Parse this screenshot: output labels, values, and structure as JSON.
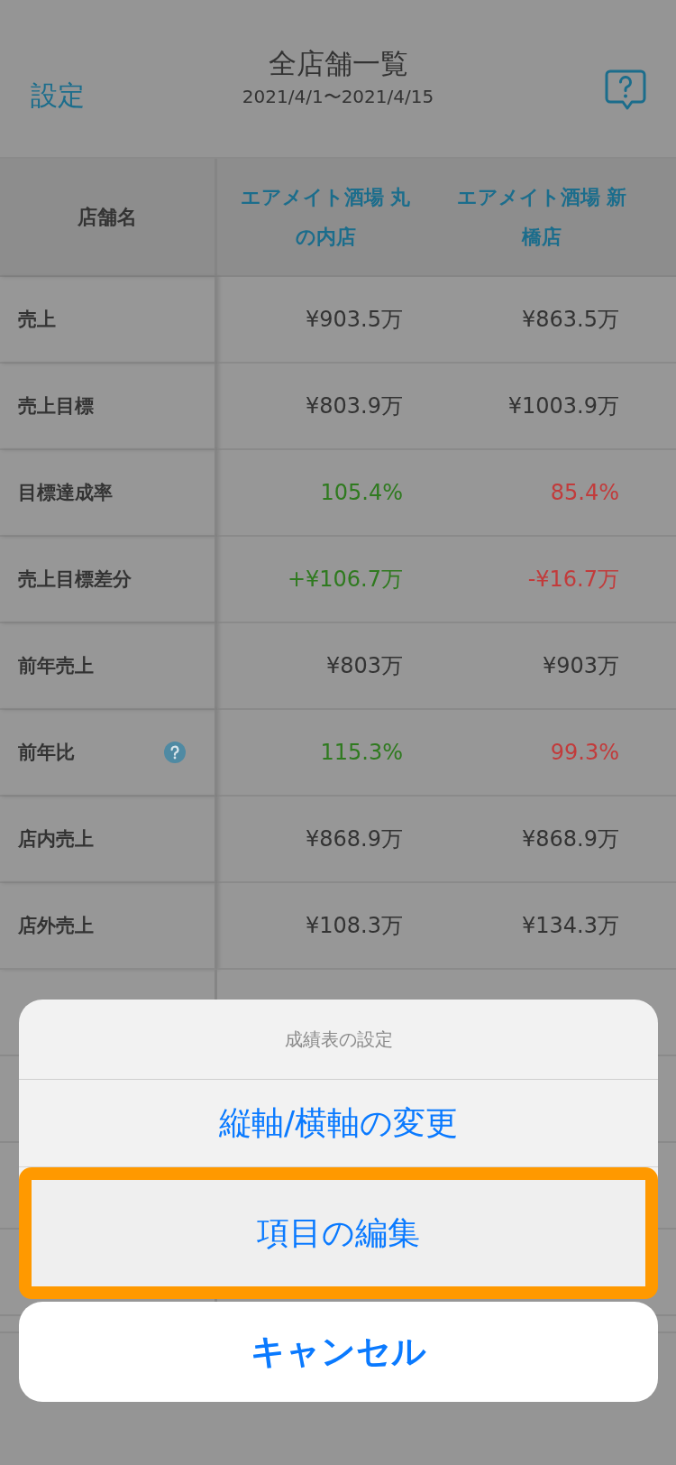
{
  "header": {
    "left_link": "設定",
    "title": "全店舗一覧",
    "subtitle": "2021/4/1〜2021/4/15"
  },
  "table": {
    "corner": "店舗名",
    "columns": [
      "エアメイト酒場 丸の内店",
      "エアメイト酒場 新橋店"
    ],
    "rows": [
      {
        "label": "売上",
        "help": false,
        "cells": [
          {
            "text": "¥903.5万",
            "color": "#333333"
          },
          {
            "text": "¥863.5万",
            "color": "#333333"
          }
        ]
      },
      {
        "label": "売上目標",
        "help": false,
        "cells": [
          {
            "text": "¥803.9万",
            "color": "#333333"
          },
          {
            "text": "¥1003.9万",
            "color": "#333333"
          }
        ]
      },
      {
        "label": "目標達成率",
        "help": false,
        "cells": [
          {
            "text": "105.4%",
            "color": "#2f7a1f"
          },
          {
            "text": "85.4%",
            "color": "#c23b3b"
          }
        ]
      },
      {
        "label": "売上目標差分",
        "help": false,
        "cells": [
          {
            "text": "+¥106.7万",
            "color": "#2f7a1f"
          },
          {
            "text": "-¥16.7万",
            "color": "#c23b3b"
          }
        ]
      },
      {
        "label": "前年売上",
        "help": false,
        "cells": [
          {
            "text": "¥803万",
            "color": "#333333"
          },
          {
            "text": "¥903万",
            "color": "#333333"
          }
        ]
      },
      {
        "label": "前年比",
        "help": true,
        "cells": [
          {
            "text": "115.3%",
            "color": "#2f7a1f"
          },
          {
            "text": "99.3%",
            "color": "#c23b3b"
          }
        ]
      },
      {
        "label": "店内売上",
        "help": false,
        "cells": [
          {
            "text": "¥868.9万",
            "color": "#333333"
          },
          {
            "text": "¥868.9万",
            "color": "#333333"
          }
        ]
      },
      {
        "label": "店外売上",
        "help": false,
        "cells": [
          {
            "text": "¥108.3万",
            "color": "#333333"
          },
          {
            "text": "¥134.3万",
            "color": "#333333"
          }
        ]
      }
    ]
  },
  "action_sheet": {
    "title": "成績表の設定",
    "actions": [
      {
        "label": "縦軸/横軸の変更",
        "highlighted": false
      },
      {
        "label": "項目の編集",
        "highlighted": true
      }
    ],
    "cancel": "キャンセル"
  }
}
